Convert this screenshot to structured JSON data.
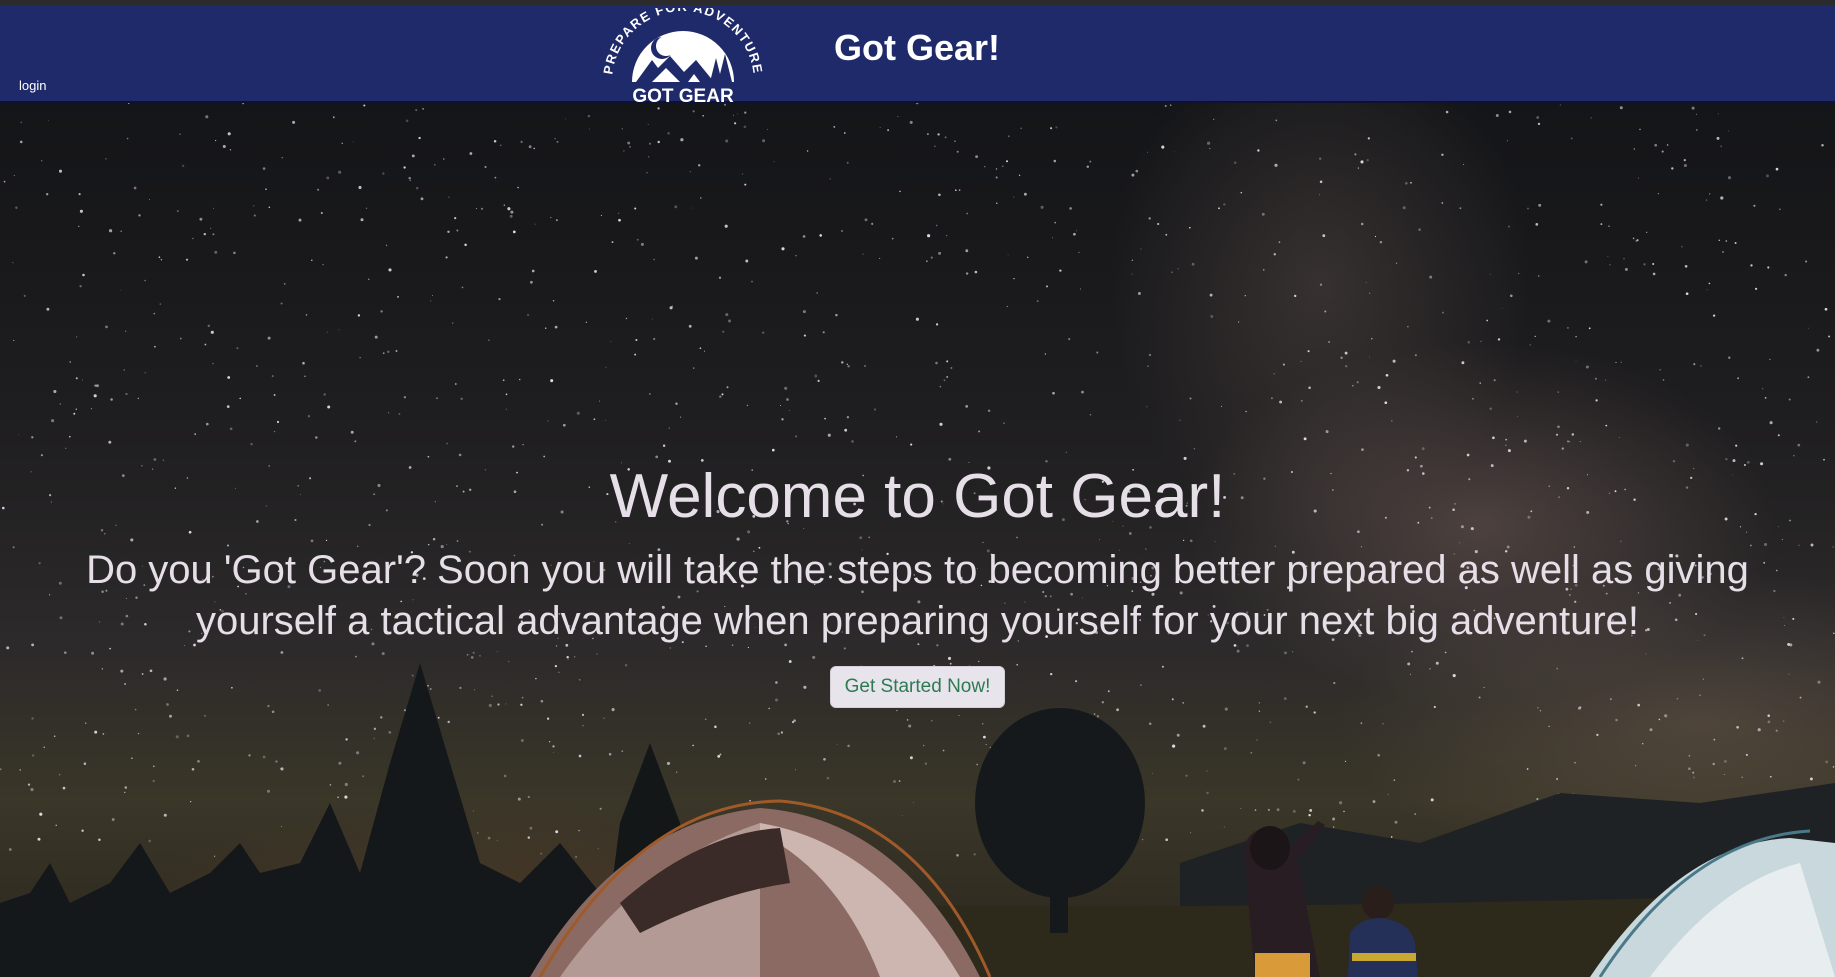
{
  "nav": {
    "login_label": "login",
    "brand_title": "Got Gear!",
    "logo": {
      "arc_text": "PREPARE FOR ADVENTURE",
      "name_text": "GOT GEAR"
    }
  },
  "hero": {
    "title": "Welcome to Got Gear!",
    "subtitle": "Do you 'Got Gear'? Soon you will take the steps to becoming better prepared as well as giving yourself a tactical advantage when preparing yourself for your next big adventure!",
    "cta_label": "Get Started Now!"
  },
  "colors": {
    "navbar": "#1f2a6b",
    "hero_text": "#e6dfe8",
    "cta_text": "#2e7a52",
    "cta_bg": "#e8e4ec"
  }
}
